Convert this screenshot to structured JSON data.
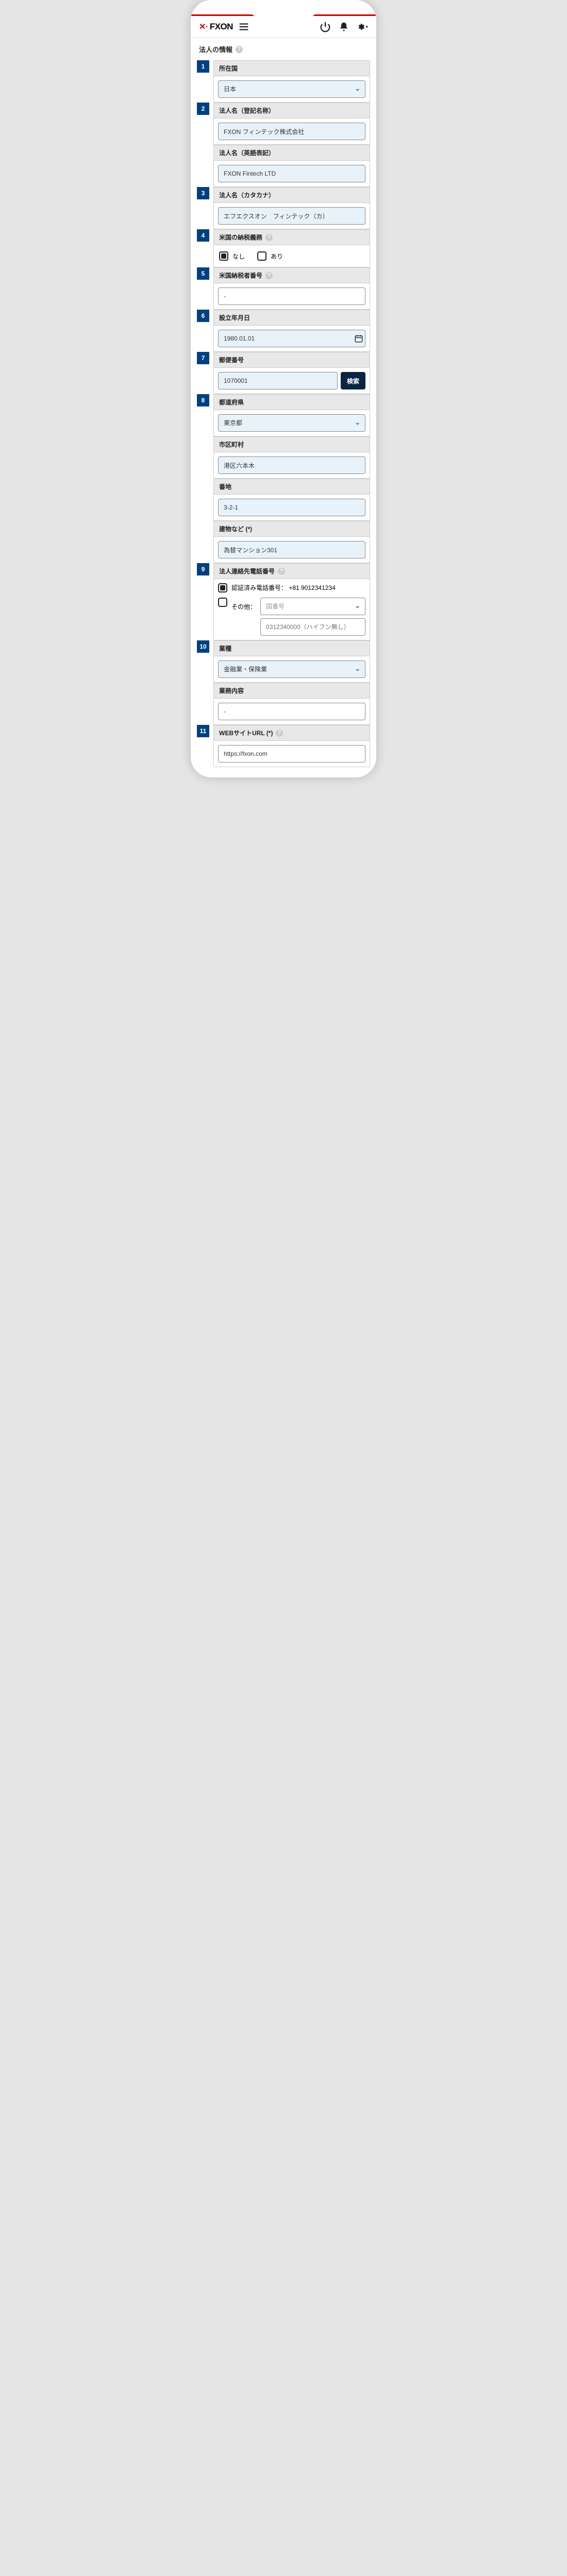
{
  "header": {
    "brand": "FXON"
  },
  "section": {
    "title": "法人の情報"
  },
  "fields": {
    "country": {
      "num": "1",
      "label": "所在国",
      "value": "日本"
    },
    "nameReg": {
      "num": "2",
      "label": "法人名（登記名称）",
      "value": "FXON フィンテック株式会社"
    },
    "nameEn": {
      "label": "法人名（英語表記）",
      "value": "FXON Fintech LTD"
    },
    "nameKana": {
      "num": "3",
      "label": "法人名（カタカナ）",
      "value": "エフエクスオン　フィンテック（カ）"
    },
    "usTax": {
      "num": "4",
      "label": "米国の納税義務",
      "none": "なし",
      "yes": "あり"
    },
    "usTin": {
      "num": "5",
      "label": "米国納税者番号",
      "value": "-"
    },
    "established": {
      "num": "6",
      "label": "設立年月日",
      "value": "1980.01.01"
    },
    "zip": {
      "num": "7",
      "label": "郵便番号",
      "value": "1070001",
      "search": "検索"
    },
    "pref": {
      "num": "8",
      "label": "都道府県",
      "value": "東京都"
    },
    "city": {
      "label": "市区町村",
      "value": "港区六本木"
    },
    "street": {
      "label": "番地",
      "value": "3-2-1"
    },
    "building": {
      "label": "建物など (*)",
      "value": "為替マンション301"
    },
    "phone": {
      "num": "9",
      "label": "法人連絡先電話番号",
      "verified": "認証済み電話番号： +81 9012341234",
      "other": "その他：",
      "ccPlaceholder": "国番号",
      "numPlaceholder": "0312340000（ハイフン無し）"
    },
    "industry": {
      "num": "10",
      "label": "業種",
      "value": "金融業・保険業"
    },
    "bizDesc": {
      "label": "業務内容",
      "value": "-"
    },
    "url": {
      "num": "11",
      "label": "WEBサイトURL (*)",
      "value": "https://fxon.com"
    }
  }
}
